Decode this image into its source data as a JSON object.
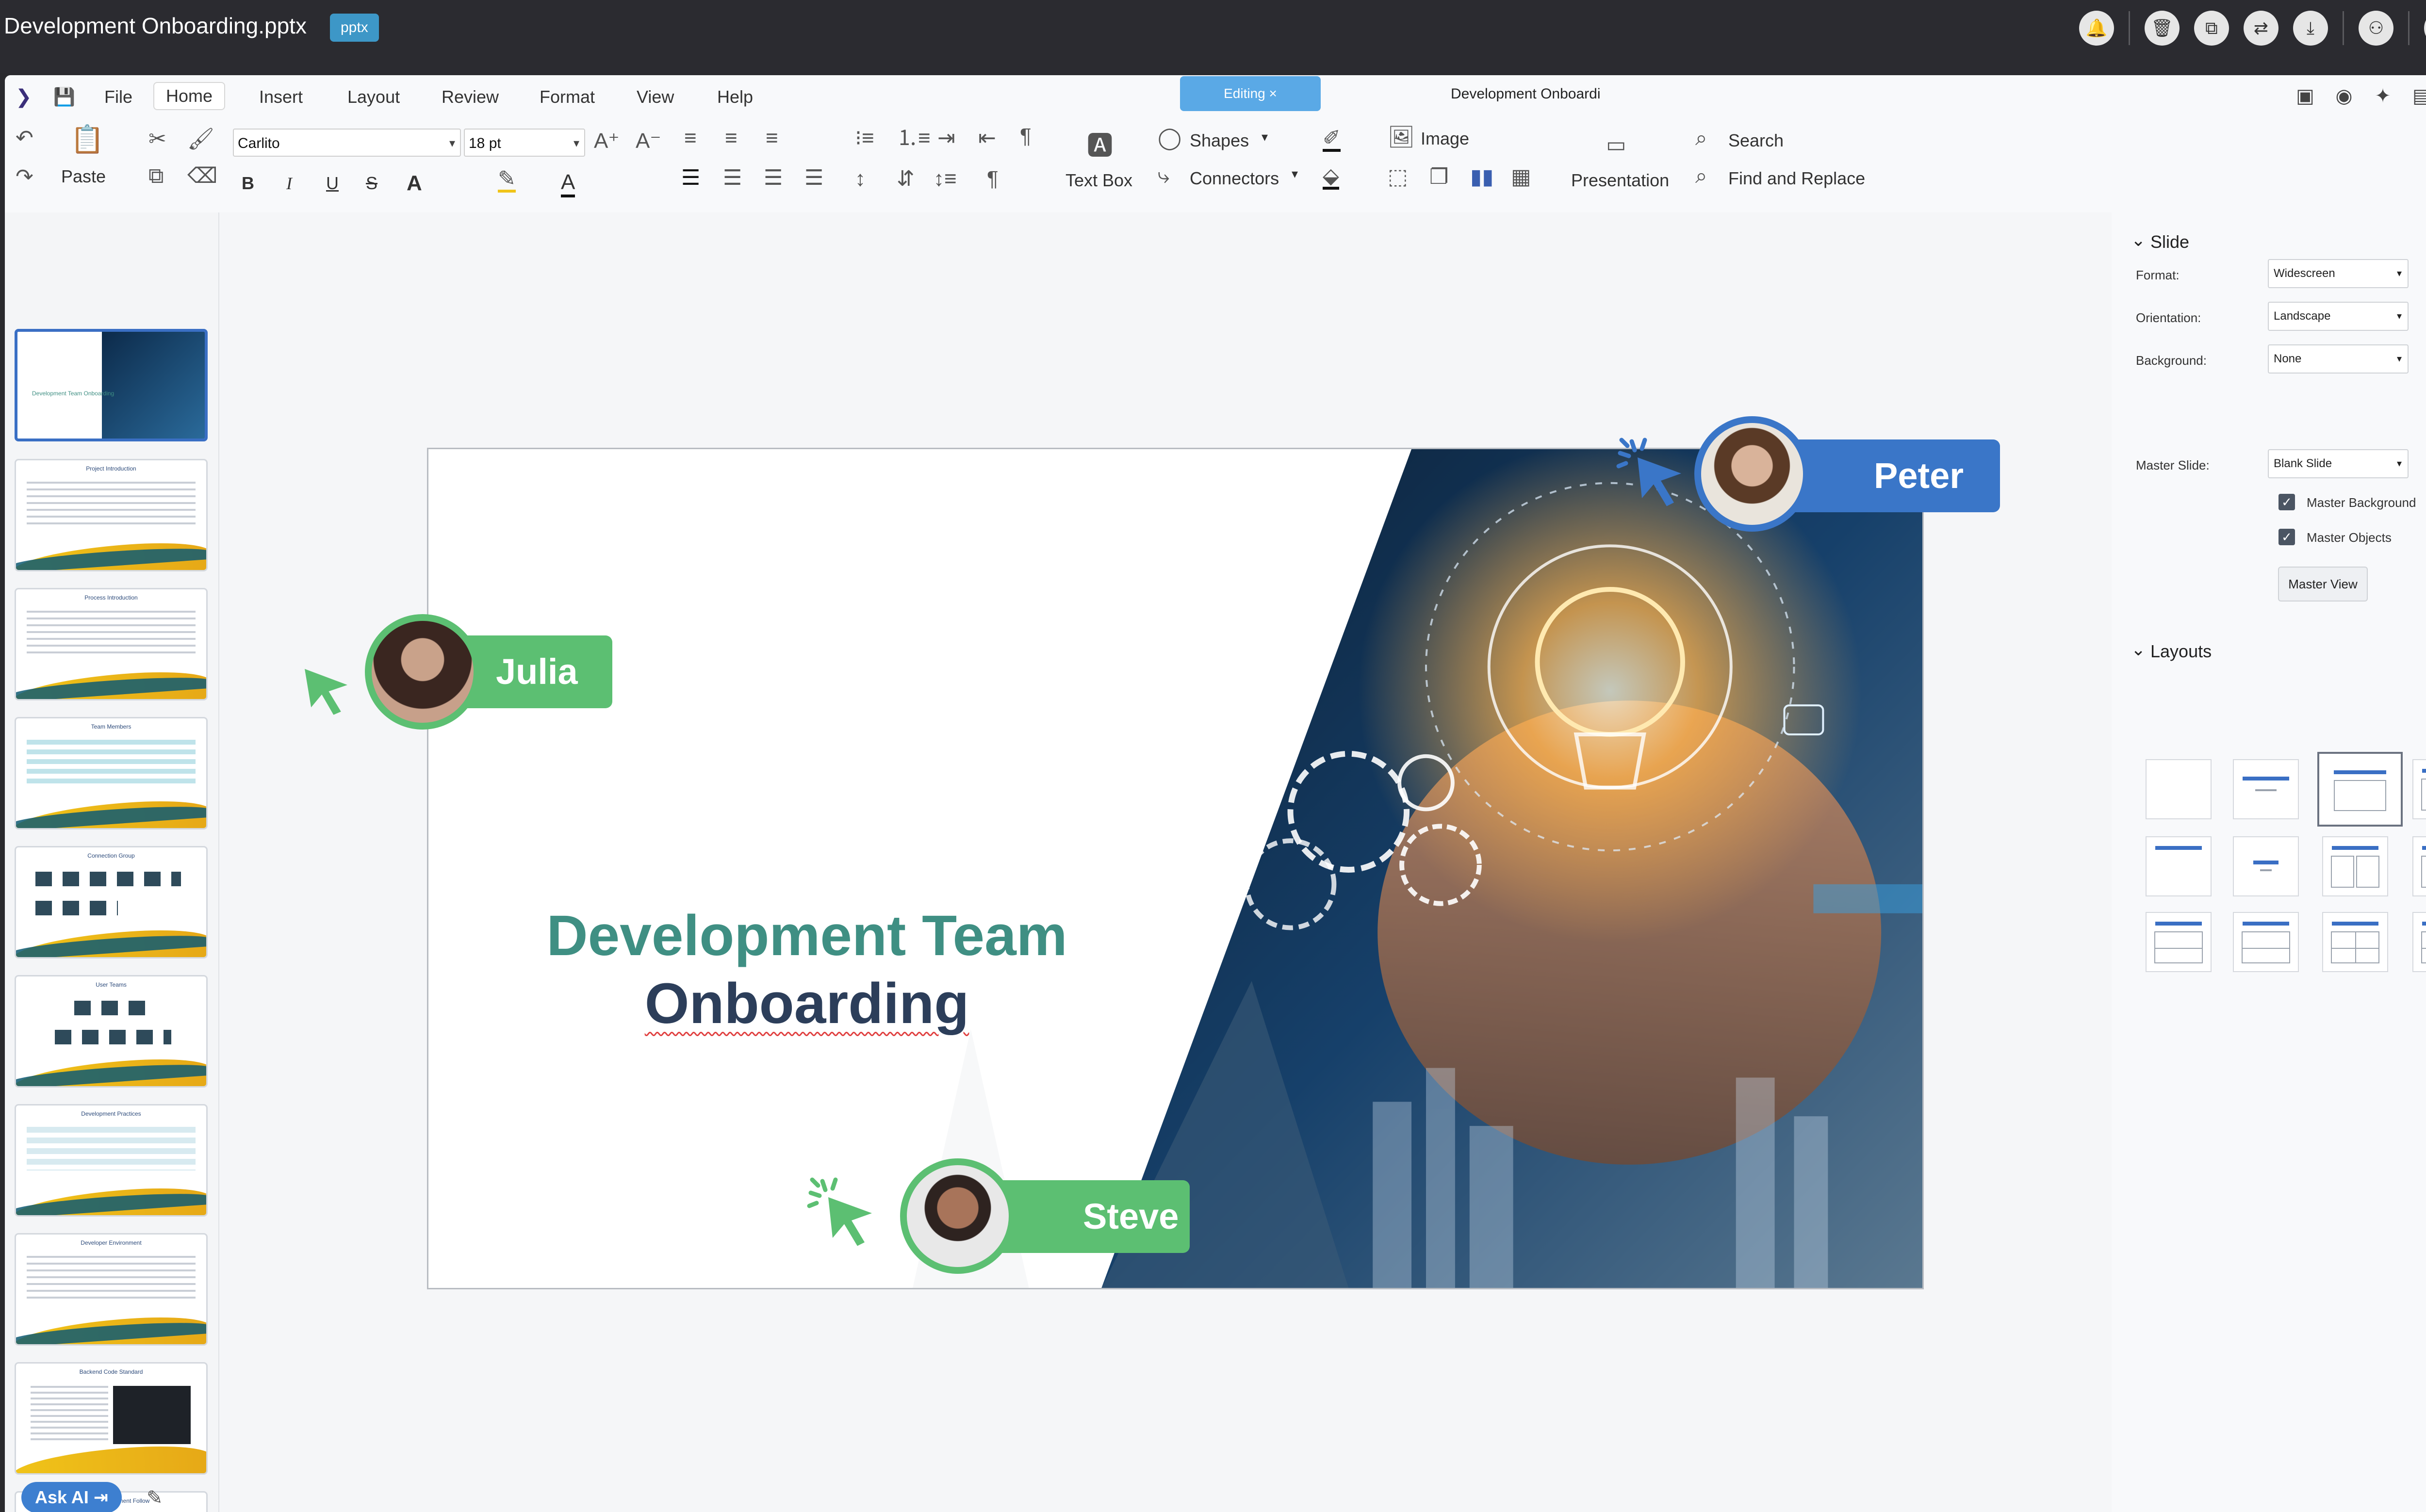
{
  "header": {
    "doc_title": "Development Onboarding.pptx",
    "badge": "pptx",
    "actions": [
      {
        "name": "notifications-icon",
        "glyph": "🔔"
      },
      {
        "name": "trash-icon",
        "glyph": "🗑"
      },
      {
        "name": "copy-icon",
        "glyph": "⧉"
      },
      {
        "name": "version-icon",
        "glyph": "⇄"
      },
      {
        "name": "download-icon",
        "glyph": "⤓"
      },
      {
        "name": "share-icon",
        "glyph": "⚇"
      },
      {
        "name": "info-icon",
        "glyph": "ⓘ"
      }
    ]
  },
  "menubar": {
    "items": [
      "File",
      "Home",
      "Insert",
      "Layout",
      "Review",
      "Format",
      "View",
      "Help"
    ],
    "active": "Home",
    "editing_label": "Editing ×",
    "center_title": "Development Onboardi"
  },
  "ribbon": {
    "paste": "Paste",
    "font_name": "Carlito",
    "font_size": "18 pt",
    "bold": "B",
    "italic": "I",
    "underline": "U",
    "strike": "S",
    "font_color": "A",
    "text_box": "Text Box",
    "shapes": "Shapes",
    "connectors": "Connectors",
    "image": "Image",
    "presentation": "Presentation",
    "search": "Search",
    "find_replace": "Find and Replace"
  },
  "thumbnails": [
    {
      "title": "Development Team Onboarding",
      "active": true
    },
    {
      "title": "Project Introduction"
    },
    {
      "title": "Process Introduction"
    },
    {
      "title": "Team Members"
    },
    {
      "title": "Connection Group"
    },
    {
      "title": "User Teams"
    },
    {
      "title": "Development Practices"
    },
    {
      "title": "Developer Environment"
    },
    {
      "title": "Backend Code Standard"
    },
    {
      "title": "Backend Development Follow"
    }
  ],
  "ask_ai": "Ask AI ⇥",
  "slide": {
    "title_line1": "Development Team",
    "title_line2": "Onboarding"
  },
  "collaborators": [
    {
      "name": "Julia",
      "color": "#5cbf72"
    },
    {
      "name": "Peter",
      "color": "#3a76c8"
    },
    {
      "name": "Steve",
      "color": "#5cbf72"
    }
  ],
  "panel": {
    "slide_section": "Slide",
    "format_label": "Format:",
    "format_value": "Widescreen",
    "orientation_label": "Orientation:",
    "orientation_value": "Landscape",
    "background_label": "Background:",
    "background_value": "None",
    "master_slide_label": "Master Slide:",
    "master_slide_value": "Blank Slide",
    "master_background": "Master Background",
    "master_objects": "Master Objects",
    "master_view": "Master View",
    "layouts_section": "Layouts"
  },
  "colors": {
    "accent_blue": "#3a6fc4",
    "title_teal": "#3f8f83",
    "title_navy": "#2c3e5a",
    "collab_green": "#5cbf72",
    "collab_blue": "#3a76c8"
  }
}
